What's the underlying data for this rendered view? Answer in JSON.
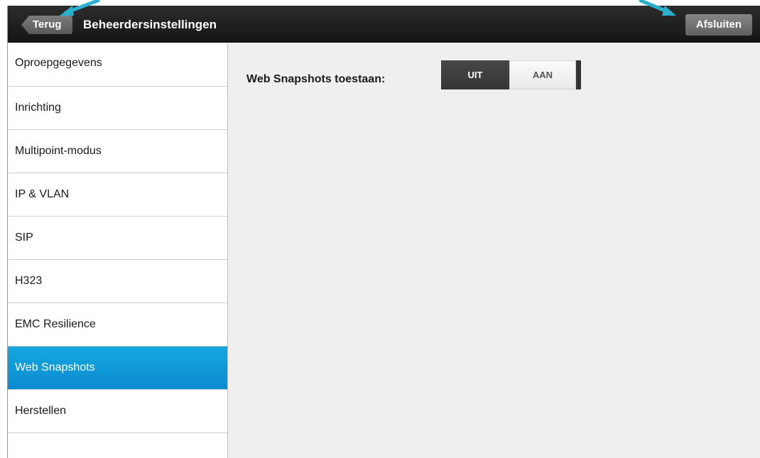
{
  "header": {
    "back_label": "Terug",
    "title": "Beheerdersinstellingen",
    "exit_label": "Afsluiten"
  },
  "sidebar": {
    "items": [
      {
        "label": "Oproepgegevens",
        "active": false
      },
      {
        "label": "Inrichting",
        "active": false
      },
      {
        "label": "Multipoint-modus",
        "active": false
      },
      {
        "label": "IP & VLAN",
        "active": false
      },
      {
        "label": "SIP",
        "active": false
      },
      {
        "label": "H323",
        "active": false
      },
      {
        "label": "EMC Resilience",
        "active": false
      },
      {
        "label": "Web Snapshots",
        "active": true
      },
      {
        "label": "Herstellen",
        "active": false
      }
    ]
  },
  "main": {
    "setting_label": "Web Snapshots toestaan:",
    "toggle": {
      "off_label": "UIT",
      "on_label": "AAN",
      "selected": "AAN"
    }
  },
  "colors": {
    "header_bg": "#1f1f1f",
    "accent": "#0f97d8",
    "callout": "#2ab0cc"
  }
}
